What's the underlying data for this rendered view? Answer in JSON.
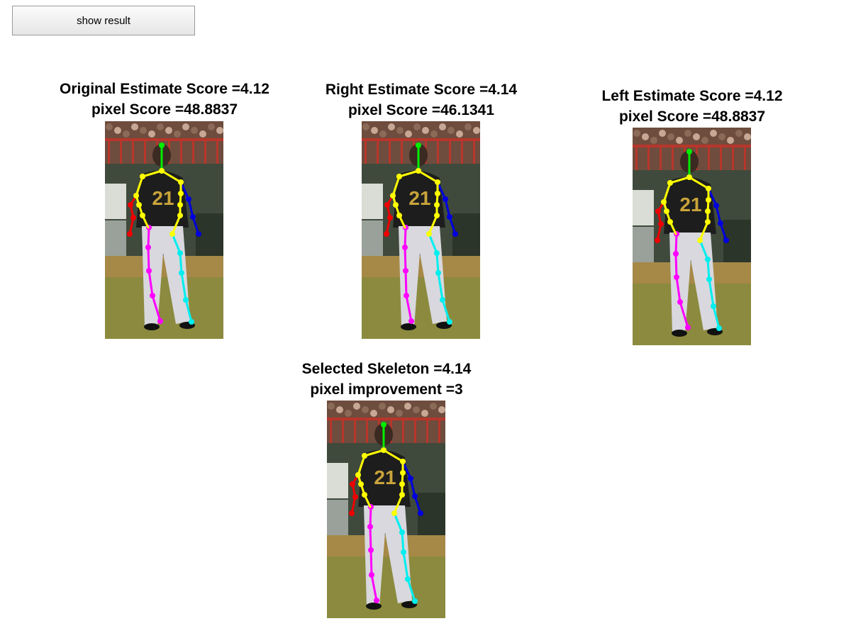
{
  "toolbar": {
    "show_result_label": "show result"
  },
  "panels": [
    {
      "id": "original",
      "line1": "Original Estimate Score =4.12",
      "line2": "pixel Score =48.8837",
      "variant": "original"
    },
    {
      "id": "right",
      "line1": "Right Estimate Score =4.14",
      "line2": "pixel Score =46.1341",
      "variant": "right"
    },
    {
      "id": "left",
      "line1": "Left Estimate Score =4.12",
      "line2": "pixel Score =48.8837",
      "variant": "original"
    },
    {
      "id": "selected",
      "line1": "Selected Skeleton =4.14",
      "line2": "pixel improvement =3",
      "variant": "right"
    }
  ],
  "photo": {
    "jersey_number": "21"
  },
  "skeleton_colors": {
    "head": "#00ee00",
    "torso": "#ffff00",
    "right_arm": "#ee0000",
    "left_arm": "#0000dd",
    "right_leg": "#ff00ff",
    "left_leg": "#00eeee"
  }
}
